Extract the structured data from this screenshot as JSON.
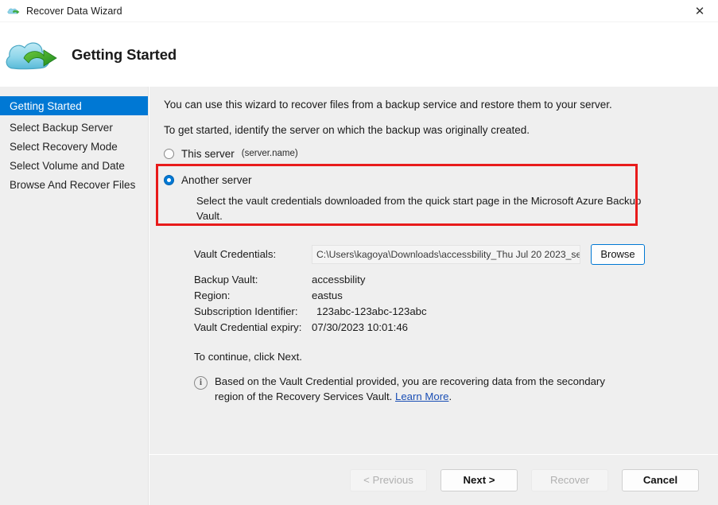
{
  "window": {
    "title": "Recover Data Wizard",
    "icon": "cloud-icon",
    "close_label": "✕"
  },
  "header": {
    "title": "Getting Started",
    "logo": "cloud-recover-logo"
  },
  "sidebar": {
    "items": [
      {
        "label": "Getting Started",
        "selected": true
      },
      {
        "label": "Select Backup Server",
        "selected": false
      },
      {
        "label": "Select Recovery Mode",
        "selected": false
      },
      {
        "label": "Select Volume and Date",
        "selected": false
      },
      {
        "label": "Browse And Recover Files",
        "selected": false
      }
    ]
  },
  "main": {
    "intro_line1": "You can use this wizard to recover files from a backup service and restore them to your server.",
    "intro_line2": "To get started, identify the server on which the backup was originally created.",
    "options": {
      "this_server": {
        "label": "This server",
        "sub_label": "(server.name)",
        "selected": false
      },
      "another_server": {
        "label": "Another server",
        "selected": true,
        "description": "Select the vault credentials downloaded from the quick start page in the Microsoft Azure Backup Vault."
      }
    },
    "highlight_color": "#e81b1b",
    "vault_credentials": {
      "label": "Vault Credentials:",
      "value": "C:\\Users\\kagoya\\Downloads\\accessbility_Thu Jul 20 2023_se",
      "browse_label": "Browse"
    },
    "details": [
      {
        "label": "Backup Vault:",
        "value": "accessbility"
      },
      {
        "label": "Region:",
        "value": "eastus"
      },
      {
        "label": "Subscription Identifier:",
        "value": "123abc-123abc-123abc"
      },
      {
        "label": "Vault Credential expiry:",
        "value": "07/30/2023 10:01:46"
      }
    ],
    "continue_text": "To continue, click Next.",
    "info": {
      "icon": "info-icon",
      "text_before": "Based on the Vault Credential provided, you are recovering data from the secondary region of the Recovery Services Vault.",
      "link_label": "Learn More",
      "text_after": "."
    }
  },
  "footer": {
    "previous": {
      "label": "< Previous",
      "enabled": false
    },
    "next": {
      "label": "Next >",
      "enabled": true
    },
    "recover": {
      "label": "Recover",
      "enabled": false
    },
    "cancel": {
      "label": "Cancel",
      "enabled": true
    }
  }
}
